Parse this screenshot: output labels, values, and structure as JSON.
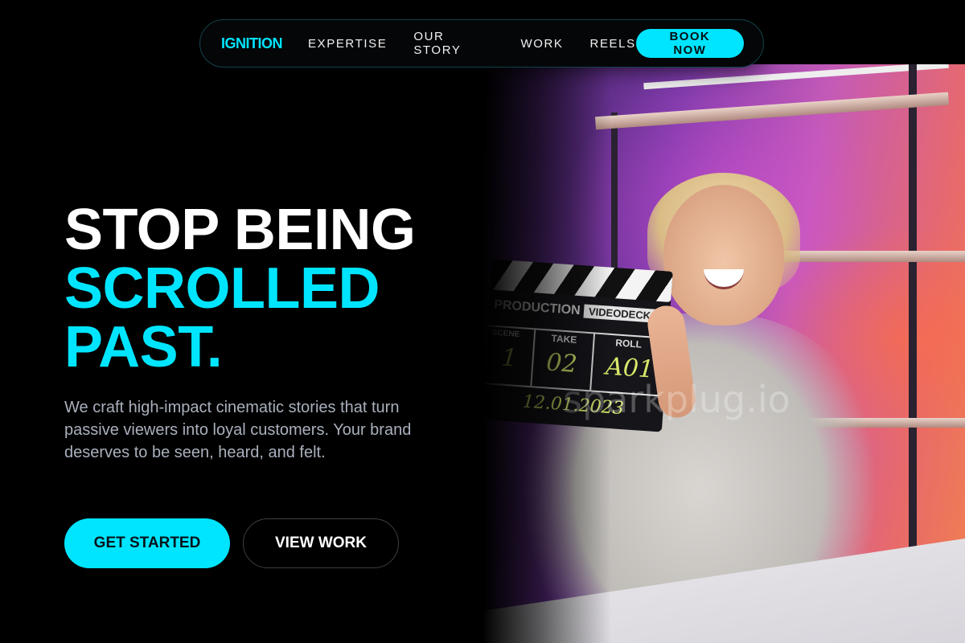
{
  "nav": {
    "logo": "IGNITION",
    "links": [
      "EXPERTISE",
      "OUR STORY",
      "WORK",
      "REELS"
    ],
    "cta": "BOOK NOW"
  },
  "hero": {
    "headline_line1": "STOP BEING",
    "headline_line2": "SCROLLED",
    "headline_line3": "PAST.",
    "subtitle": "We craft high-impact cinematic stories that turn passive viewers into loyal customers. Your brand deserves to be seen, heard, and felt.",
    "primary_button": "GET STARTED",
    "secondary_button": "VIEW WORK"
  },
  "image": {
    "clapper_production": "PRODUCTION",
    "clapper_title": "VIDEODECK",
    "clapper_scene": "SCENE",
    "clapper_take": "TAKE",
    "clapper_roll": "ROLL",
    "clapper_scene_value": "1",
    "clapper_take_value": "02",
    "clapper_roll_value": "A01",
    "clapper_date": "12.01.2023",
    "watermark": "sparkplug.io"
  },
  "colors": {
    "accent": "#00e5ff",
    "background": "#000000",
    "subtitle_text": "#a9b0bc"
  }
}
